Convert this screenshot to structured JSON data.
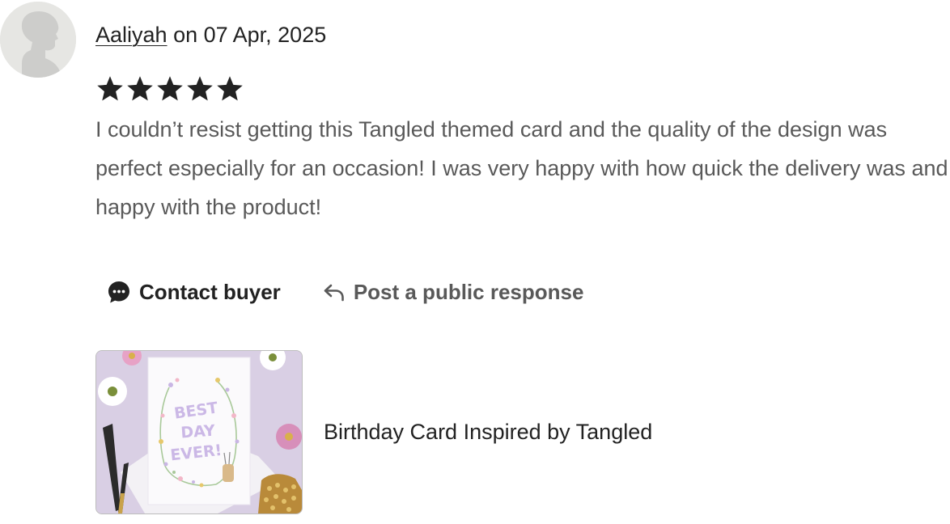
{
  "review": {
    "reviewer_name": "Aaliyah",
    "date_text": " on 07 Apr, 2025",
    "rating": 5,
    "rating_max": 5,
    "text": "I couldn’t resist getting this Tangled themed card and the quality of the design was perfect especially for an occasion! I was very happy with how quick the delivery was and happy with the product!"
  },
  "actions": {
    "contact_label": "Contact buyer",
    "respond_label": "Post a public response"
  },
  "listing": {
    "title": "Birthday Card Inspired by Tangled",
    "card_text": [
      "BEST",
      "DAY",
      "EVER!"
    ]
  },
  "icons": {
    "avatar": "user-silhouette-icon",
    "star": "star-icon",
    "contact": "chat-bubble-icon",
    "respond": "reply-arrow-icon"
  },
  "colors": {
    "text_primary": "#222222",
    "text_secondary": "#595959",
    "star": "#222222",
    "avatar_bg": "#e6e6e3",
    "card_lettering": "#c9b6e4"
  }
}
